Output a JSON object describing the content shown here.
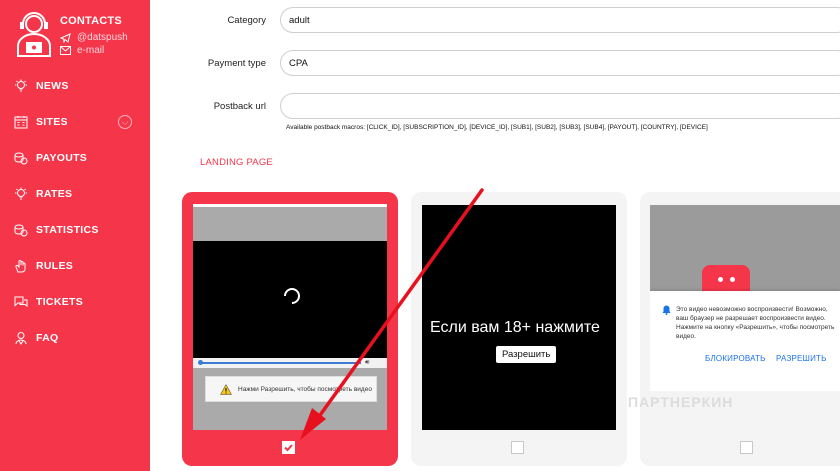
{
  "sidebar": {
    "contacts_title": "CONTACTS",
    "telegram": "@datspush",
    "email": "e-mail",
    "items": [
      {
        "label": "NEWS",
        "icon": "lightbulb-icon"
      },
      {
        "label": "SITES",
        "icon": "calendar-icon"
      },
      {
        "label": "PAYOUTS",
        "icon": "coins-icon"
      },
      {
        "label": "RATES",
        "icon": "lightbulb-icon"
      },
      {
        "label": "STATISTICS",
        "icon": "coins-icon"
      },
      {
        "label": "RULES",
        "icon": "hand-icon"
      },
      {
        "label": "TICKETS",
        "icon": "chat-icon"
      },
      {
        "label": "FAQ",
        "icon": "person-icon"
      }
    ]
  },
  "form": {
    "category_label": "Category",
    "category_value": "adult",
    "payment_label": "Payment type",
    "payment_value": "CPA",
    "postback_label": "Postback url",
    "postback_value": "",
    "macros_text": "Available postback macros: [CLICK_ID], [SUBSCRIPTION_ID], [DEVICE_ID], [SUB1], [SUB2], [SUB3], [SUB4], [PAYOUT], [COUNTRY], [DEVICE]"
  },
  "landing": {
    "title": "LANDING PAGE",
    "card1_warning": "Нажми Разрешить, чтобы посмотреть видео",
    "card2_text": "Если вам 18+ нажмите",
    "card2_button": "Разрешить",
    "card3_notice": "Это видео невозможно воспроизвести! Возможно, ваш браузер не разрешает воспроизвести видео. Нажмите на кнопку «Разрешить», чтобы посмотреть видео.",
    "card3_block": "БЛОКИРОВАТЬ",
    "card3_allow": "РАЗРЕШИТЬ"
  },
  "watermark": "ПАРТНЕРКИН",
  "colors": {
    "accent": "#f5364a",
    "link": "#1a73e8"
  }
}
